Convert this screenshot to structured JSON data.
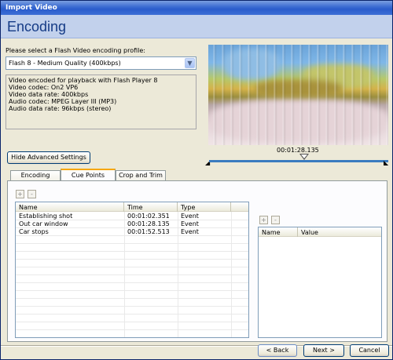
{
  "window": {
    "title": "Import Video"
  },
  "header": {
    "title": "Encoding"
  },
  "profile": {
    "label": "Please select a Flash Video encoding profile:",
    "selected": "Flash 8 - Medium Quality (400kbps)",
    "details": [
      "Video encoded for playback with Flash Player 8",
      "Video codec: On2 VP6",
      "Video data rate: 400kbps",
      "Audio codec: MPEG Layer III (MP3)",
      "Audio data rate: 96kbps (stereo)"
    ]
  },
  "preview": {
    "timecode": "00:01:28.135",
    "playhead_fraction": 0.53
  },
  "advanced_button": "Hide Advanced Settings",
  "tabs": [
    {
      "label": "Encoding",
      "active": false
    },
    {
      "label": "Cue Points",
      "active": true
    },
    {
      "label": "Crop and Trim",
      "active": false
    }
  ],
  "cue_points": {
    "add_label": "+",
    "remove_label": "-",
    "columns": [
      "Name",
      "Time",
      "Type"
    ],
    "rows": [
      {
        "name": "Establishing shot",
        "time": "00:01:02.351",
        "type": "Event"
      },
      {
        "name": "Out car window",
        "time": "00:01:28.135",
        "type": "Event"
      },
      {
        "name": "Car stops",
        "time": "00:01:52.513",
        "type": "Event"
      }
    ]
  },
  "parameters": {
    "add_label": "+",
    "remove_label": "-",
    "columns": [
      "Name",
      "Value"
    ]
  },
  "footer": {
    "back": "< Back",
    "next": "Next >",
    "cancel": "Cancel"
  },
  "colors": {
    "titlebar": "#2a5ccc",
    "header_bg": "#c2d1ec",
    "header_text": "#153b86",
    "active_tab_accent": "#f7a700",
    "scrub_track": "#3a7bbf"
  }
}
